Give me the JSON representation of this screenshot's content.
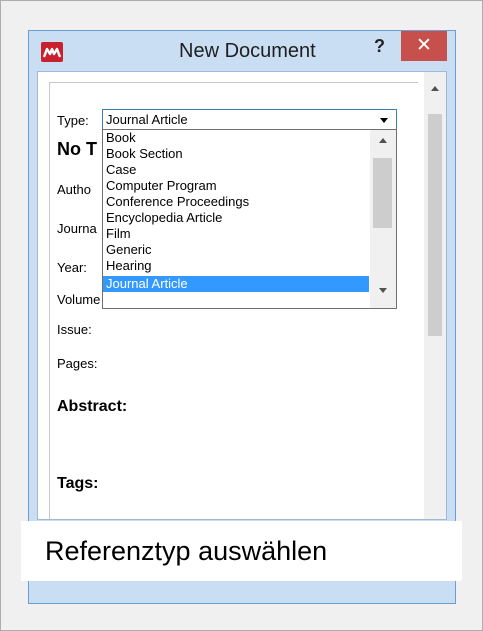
{
  "window": {
    "title": "New Document",
    "help_label": "?",
    "close_label": "✕",
    "accent": "#c7504d",
    "frame_color": "#c9ddf3"
  },
  "form": {
    "type_label": "Type:",
    "type_value": "Journal Article",
    "title_placeholder": "No T",
    "fields": [
      {
        "label": "Autho"
      },
      {
        "label": "Journa"
      },
      {
        "label": "Year:"
      },
      {
        "label": "Volume"
      },
      {
        "label": "Issue:"
      },
      {
        "label": "Pages:"
      }
    ],
    "abstract_label": "Abstract:",
    "tags_label": "Tags:"
  },
  "dropdown": {
    "options": [
      "Book",
      "Book Section",
      "Case",
      "Computer Program",
      "Conference Proceedings",
      "Encyclopedia Article",
      "Film",
      "Generic",
      "Hearing",
      "Journal Article"
    ],
    "selected_index": 9,
    "selection_color": "#3399ff"
  },
  "caption": {
    "text": "Referenztyp auswählen"
  }
}
